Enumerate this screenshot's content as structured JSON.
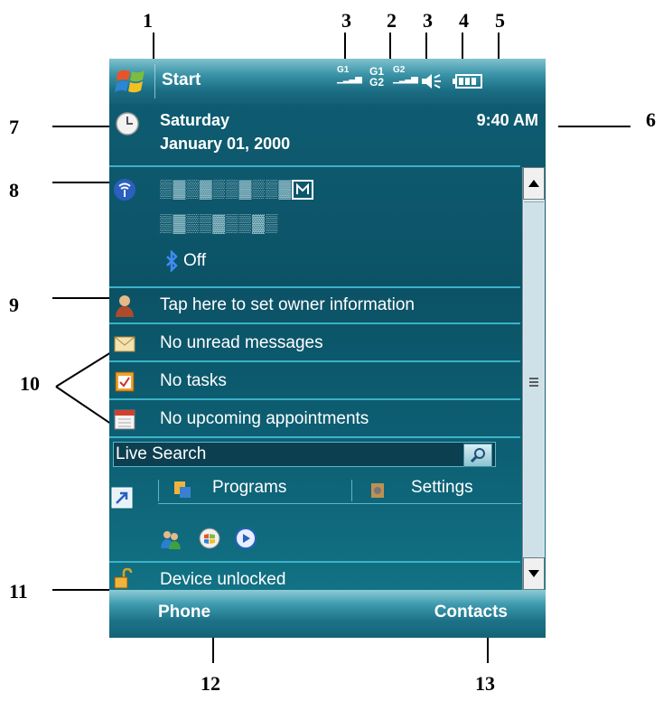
{
  "callouts": [
    "1",
    "2",
    "3",
    "3",
    "4",
    "5",
    "6",
    "7",
    "8",
    "9",
    "10",
    "11",
    "12",
    "13"
  ],
  "titlebar": {
    "start_label": "Start",
    "signal_labels": [
      "G1",
      "G1",
      "G2",
      "G2"
    ]
  },
  "date": {
    "day": "Saturday",
    "date": "January 01, 2000",
    "time": "9:40 AM"
  },
  "today": {
    "bluetooth_label": "Off",
    "owner_info": "Tap here to set owner information",
    "messages": "No unread messages",
    "tasks": "No tasks",
    "appointments": "No upcoming appointments",
    "search_placeholder": "Live Search",
    "tabs": [
      "Programs",
      "Settings"
    ],
    "lock_status": "Device unlocked"
  },
  "softkeys": {
    "left": "Phone",
    "right": "Contacts"
  },
  "colors": {
    "accent": "#3ab3c8",
    "background": "#0f5e74"
  }
}
